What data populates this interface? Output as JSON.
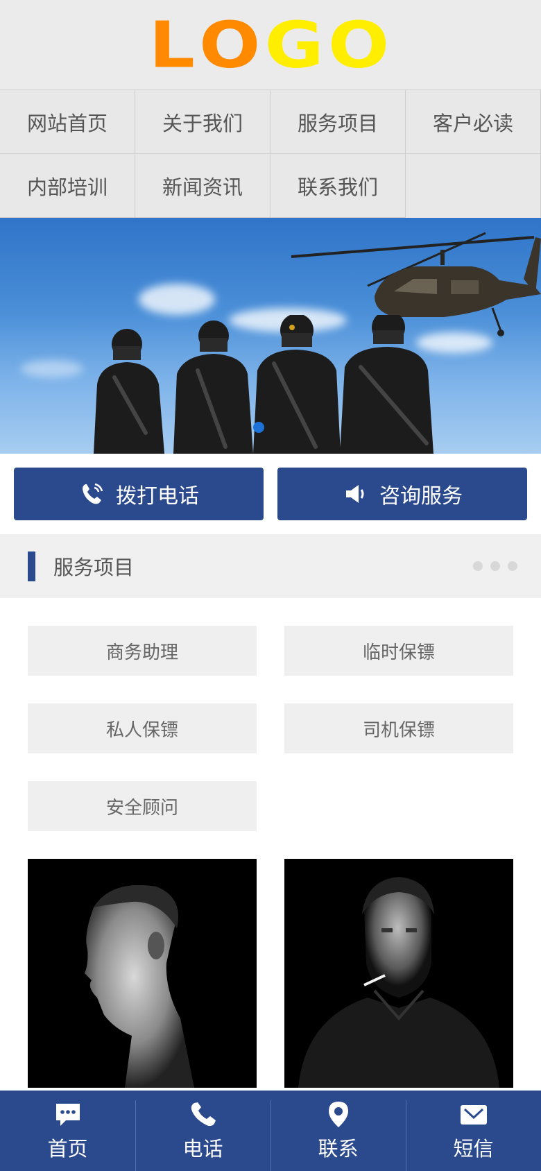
{
  "logo": {
    "letters": [
      "L",
      "O",
      "G",
      "O"
    ]
  },
  "nav": {
    "items": [
      {
        "label": "网站首页"
      },
      {
        "label": "关于我们"
      },
      {
        "label": "服务项目"
      },
      {
        "label": "客户必读"
      },
      {
        "label": "内部培训"
      },
      {
        "label": "新闻资讯"
      },
      {
        "label": "联系我们"
      }
    ]
  },
  "banner": {
    "slides": 1,
    "active_index": 0
  },
  "cta": {
    "call_label": "拨打电话",
    "consult_label": "咨询服务",
    "call_icon": "phone-icon",
    "consult_icon": "speaker-icon"
  },
  "section": {
    "title": "服务项目"
  },
  "services": {
    "items": [
      {
        "label": "商务助理"
      },
      {
        "label": "临时保镖"
      },
      {
        "label": "私人保镖"
      },
      {
        "label": "司机保镖"
      },
      {
        "label": "安全顾问"
      }
    ]
  },
  "bottom_bar": {
    "tabs": [
      {
        "label": "首页",
        "icon": "chat-icon"
      },
      {
        "label": "电话",
        "icon": "phone-icon"
      },
      {
        "label": "联系",
        "icon": "location-pin-icon"
      },
      {
        "label": "短信",
        "icon": "envelope-icon"
      }
    ]
  },
  "colors": {
    "primary": "#2b4a8d",
    "logo_orange": "#ff8a00",
    "logo_yellow": "#ffee00",
    "banner_dot": "#1e73d8"
  }
}
